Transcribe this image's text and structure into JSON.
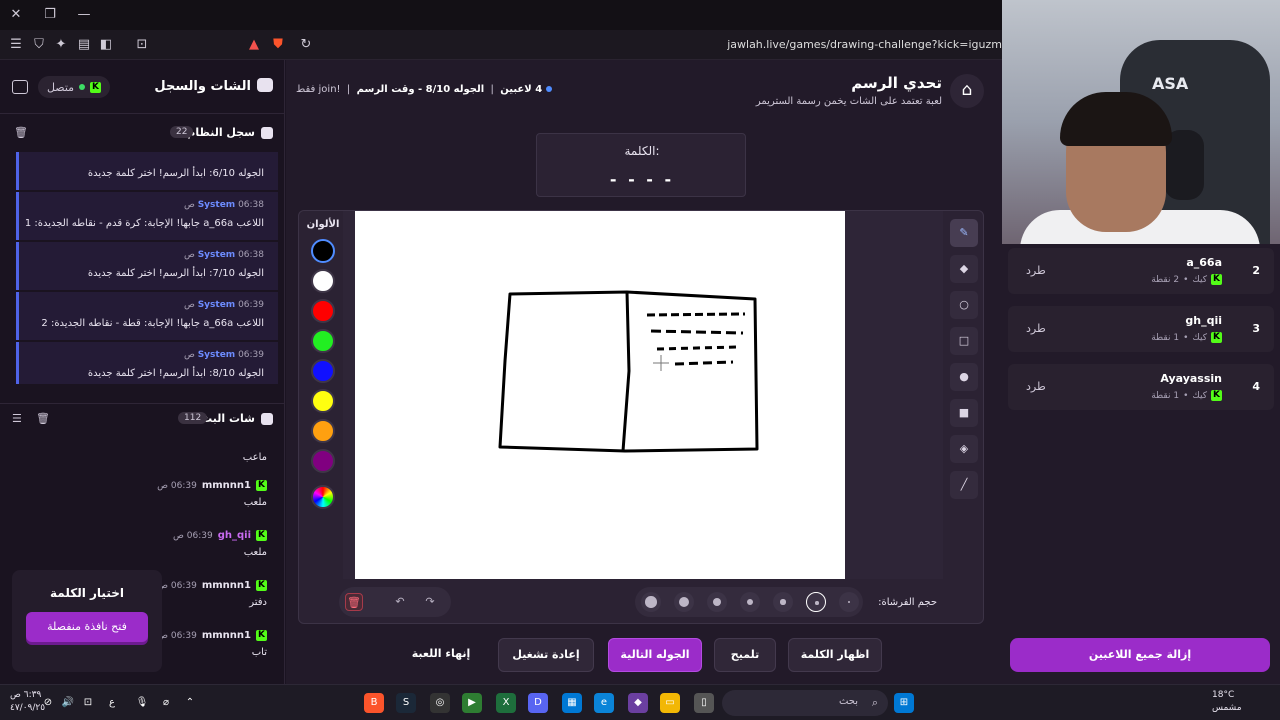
{
  "browser": {
    "url": "jawlah.live/games/drawing-challenge?kick=iguzm"
  },
  "left_panel": {
    "title": "الشات والسجل",
    "online_label": "متصل",
    "system_log": {
      "title": "سجل النظام",
      "count": "22",
      "messages": [
        {
          "sender": "",
          "time": "",
          "text": "الجوله 6/10: ابدأ الرسم! اختر كلمة جديدة"
        },
        {
          "sender": "System",
          "time": "06:38 ص",
          "text": "اللاعب a_66a جابها! الإجابة: كرة قدم - نقاطه الجديدة: 1"
        },
        {
          "sender": "System",
          "time": "06:38 ص",
          "text": "الجوله 7/10: ابدأ الرسم! اختر كلمة جديدة"
        },
        {
          "sender": "System",
          "time": "06:39 ص",
          "text": "اللاعب a_66a جابها! الإجابة: قطة - نقاطه الجديدة: 2"
        },
        {
          "sender": "System",
          "time": "06:39 ص",
          "text": "الجوله 8/10: ابدأ الرسم! اختر كلمة جديدة"
        }
      ]
    },
    "stream_chat": {
      "title": "شات البث",
      "count": "112",
      "messages": [
        {
          "user": "",
          "time": "",
          "text": "ماعب"
        },
        {
          "user": "mmnnn1",
          "time": "06:39 ص",
          "text": "ملعب"
        },
        {
          "user": "gh_qii",
          "time": "06:39 ص",
          "text": "ملعب"
        },
        {
          "user": "mmnnn1",
          "time": "06:39 ص",
          "text": "دفتر"
        },
        {
          "user": "mmnnn1",
          "time": "06:39 ص",
          "text": "تاب"
        }
      ]
    },
    "word_pick": {
      "title": "اختيار الكلمة",
      "button": "فتح نافذة منفصلة"
    }
  },
  "game": {
    "title": "تحدي الرسم",
    "subtitle": "لعبة تعتمد على الشات يخمن رسمة الستريمر",
    "players_count": "4 لاعبين",
    "round_info": "الجوله 8/10 - وقت الرسم",
    "join_hint": "!join فقط",
    "word_label": "الكلمة:",
    "word_blanks": "- - - -",
    "colors_label": "الألوان",
    "colors": [
      "#000000",
      "#ffffff",
      "#ff0000",
      "#22ee22",
      "#1010ff",
      "#ffff10",
      "#ffa010",
      "#800080"
    ],
    "brush_label": "حجم الفرشاة:",
    "brush_sizes": [
      1,
      2,
      3,
      4,
      5,
      6,
      7
    ],
    "brush_selected": 2,
    "actions": {
      "show_word": "اظهار الكلمة",
      "hint": "تلميح",
      "next_round": "الجوله التالية",
      "restart": "إعادة تشغيل",
      "end_game": "إنهاء اللعبة"
    }
  },
  "right_panel": {
    "cam_logo": "ASA",
    "players": [
      {
        "rank": "2",
        "name": "a_66a",
        "platform": "كيك",
        "points": "2 نقطة",
        "kick_label": "طرد"
      },
      {
        "rank": "3",
        "name": "gh_qii",
        "platform": "كيك",
        "points": "1 نقطة",
        "kick_label": "طرد"
      },
      {
        "rank": "4",
        "name": "Ayayassin",
        "platform": "كيك",
        "points": "1 نقطة",
        "kick_label": "طرد"
      }
    ],
    "clear_all": "إزالة جميع اللاعبين"
  },
  "taskbar": {
    "search": "بحث",
    "weather_temp": "18°C",
    "weather_desc": "مشمس",
    "time": "٦:٣٩ ص",
    "date": "٤٧/٠٩/٢٥",
    "lang": "ع"
  },
  "colors": {
    "accent_purple": "#9b2cc9",
    "system_blue": "#4f63e8",
    "kick_green": "#53fc18"
  }
}
